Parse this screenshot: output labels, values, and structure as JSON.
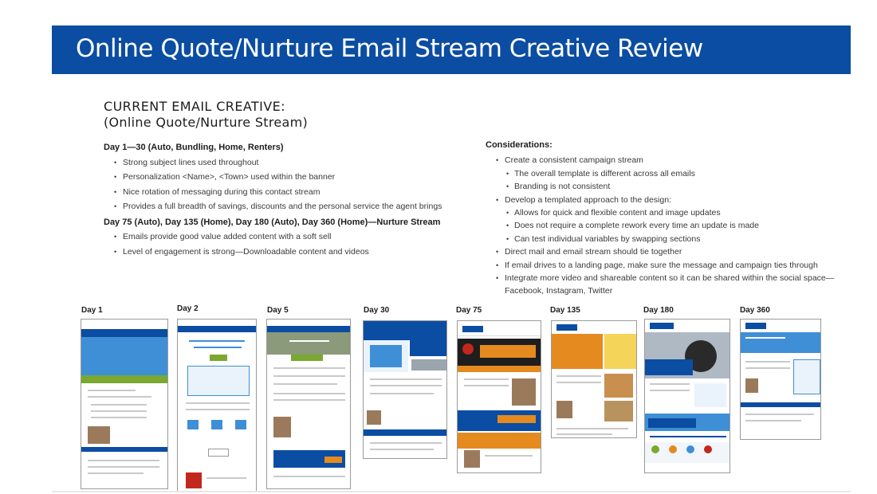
{
  "title": "Online Quote/Nurture Email Stream Creative Review",
  "heading": {
    "line1": "CURRENT EMAIL CREATIVE:",
    "line2": "(Online Quote/Nurture Stream)"
  },
  "left": {
    "section1_title": "Day 1—30 (Auto, Bundling, Home, Renters)",
    "section1_items": [
      "Strong subject lines used throughout",
      "Personalization <Name>, <Town> used within the banner",
      "Nice rotation of messaging during this contact stream",
      "Provides a full breadth of savings, discounts and the personal service the agent brings"
    ],
    "section2_title": "Day 75 (Auto), Day 135 (Home), Day 180 (Auto), Day 360 (Home)—Nurture Stream",
    "section2_items": [
      "Emails provide good value added content with a soft sell",
      "Level of engagement is strong—Downloadable content and videos"
    ]
  },
  "considerations": {
    "title": "Considerations:",
    "items": [
      "Create a consistent campaign stream",
      "The overall template is different across all emails",
      "Branding is not consistent",
      "Develop a templated approach to the design:",
      "Allows for quick and flexible content and image updates",
      "Does not require a complete rework every time an update is made",
      "Can test individual variables by swapping sections",
      "Direct mail and email stream should tie together",
      "If email drives to a landing page, make sure the message and campaign ties through",
      "Integrate more video and shareable content so it can be shared within the social space—Facebook, Instagram, Twitter"
    ]
  },
  "days": [
    "Day 1",
    "Day 2",
    "Day 5",
    "Day 30",
    "Day 75",
    "Day 135",
    "Day 180",
    "Day 360"
  ],
  "colors": {
    "banner": "#0b4da2",
    "allstate_blue": "#0b4da2",
    "accent_green": "#7aa830",
    "accent_orange": "#e58a1f",
    "accent_red": "#c2271d",
    "light_blue": "#3f8fd6"
  }
}
